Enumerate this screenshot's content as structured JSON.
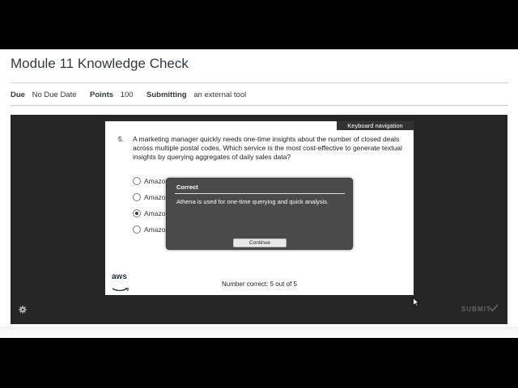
{
  "page": {
    "title": "Module 11 Knowledge Check",
    "due_label": "Due",
    "due_value": "No Due Date",
    "points_label": "Points",
    "points_value": "100",
    "submitting_label": "Submitting",
    "submitting_value": "an external tool"
  },
  "quiz": {
    "keyboard_nav": "Keyboard navigation",
    "question_number": "5.",
    "question_text": "A marketing manager quickly needs one-time insights about the number of closed deals across multiple postal codes. Which service is the most cost-effective to generate textual insights by querying aggregates of daily sales data?",
    "options": [
      {
        "label": "Amazon OpenSearch Service",
        "selected": false
      },
      {
        "label": "Amazon",
        "selected": false
      },
      {
        "label": "Amazon",
        "selected": true
      },
      {
        "label": "Amazon",
        "selected": false
      }
    ],
    "logo_text": "aws",
    "score_text": "Number correct: 5 out of 5"
  },
  "dialog": {
    "title": "Correct",
    "message": "Athena is used for one-time querying and quick analysis.",
    "button_label": "Continue"
  },
  "player": {
    "submit_label": "SUBMIT",
    "gear_icon": "gear-icon",
    "check_icon": "checkmark-icon"
  }
}
